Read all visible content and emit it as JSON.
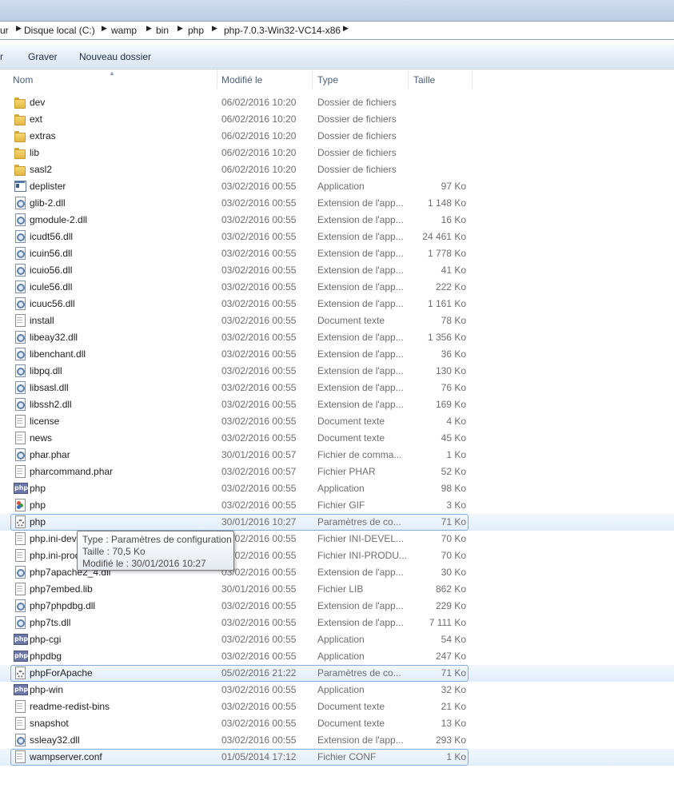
{
  "breadcrumb": [
    "ur",
    "Disque local (C:)",
    "wamp",
    "bin",
    "php",
    "php-7.0.3-Win32-VC14-x86"
  ],
  "toolbar": {
    "partial_label": "r",
    "burn_label": "Graver",
    "new_folder_label": "Nouveau dossier"
  },
  "columns": {
    "name": "Nom",
    "modified": "Modifié le",
    "type": "Type",
    "size": "Taille"
  },
  "files": [
    {
      "name": "dev",
      "date": "06/02/2016 10:20",
      "type": "Dossier de fichiers",
      "size": "",
      "icon": "folder"
    },
    {
      "name": "ext",
      "date": "06/02/2016 10:20",
      "type": "Dossier de fichiers",
      "size": "",
      "icon": "folder"
    },
    {
      "name": "extras",
      "date": "06/02/2016 10:20",
      "type": "Dossier de fichiers",
      "size": "",
      "icon": "folder"
    },
    {
      "name": "lib",
      "date": "06/02/2016 10:20",
      "type": "Dossier de fichiers",
      "size": "",
      "icon": "folder"
    },
    {
      "name": "sasl2",
      "date": "06/02/2016 10:20",
      "type": "Dossier de fichiers",
      "size": "",
      "icon": "folder"
    },
    {
      "name": "deplister",
      "date": "03/02/2016 00:55",
      "type": "Application",
      "size": "97 Ko",
      "icon": "app"
    },
    {
      "name": "glib-2.dll",
      "date": "03/02/2016 00:55",
      "type": "Extension de l'app...",
      "size": "1 148 Ko",
      "icon": "dll"
    },
    {
      "name": "gmodule-2.dll",
      "date": "03/02/2016 00:55",
      "type": "Extension de l'app...",
      "size": "16 Ko",
      "icon": "dll"
    },
    {
      "name": "icudt56.dll",
      "date": "03/02/2016 00:55",
      "type": "Extension de l'app...",
      "size": "24 461 Ko",
      "icon": "dll"
    },
    {
      "name": "icuin56.dll",
      "date": "03/02/2016 00:55",
      "type": "Extension de l'app...",
      "size": "1 778 Ko",
      "icon": "dll"
    },
    {
      "name": "icuio56.dll",
      "date": "03/02/2016 00:55",
      "type": "Extension de l'app...",
      "size": "41 Ko",
      "icon": "dll"
    },
    {
      "name": "icule56.dll",
      "date": "03/02/2016 00:55",
      "type": "Extension de l'app...",
      "size": "222 Ko",
      "icon": "dll"
    },
    {
      "name": "icuuc56.dll",
      "date": "03/02/2016 00:55",
      "type": "Extension de l'app...",
      "size": "1 161 Ko",
      "icon": "dll"
    },
    {
      "name": "install",
      "date": "03/02/2016 00:55",
      "type": "Document texte",
      "size": "78 Ko",
      "icon": "doc"
    },
    {
      "name": "libeay32.dll",
      "date": "03/02/2016 00:55",
      "type": "Extension de l'app...",
      "size": "1 356 Ko",
      "icon": "dll"
    },
    {
      "name": "libenchant.dll",
      "date": "03/02/2016 00:55",
      "type": "Extension de l'app...",
      "size": "36 Ko",
      "icon": "dll"
    },
    {
      "name": "libpq.dll",
      "date": "03/02/2016 00:55",
      "type": "Extension de l'app...",
      "size": "130 Ko",
      "icon": "dll"
    },
    {
      "name": "libsasl.dll",
      "date": "03/02/2016 00:55",
      "type": "Extension de l'app...",
      "size": "76 Ko",
      "icon": "dll"
    },
    {
      "name": "libssh2.dll",
      "date": "03/02/2016 00:55",
      "type": "Extension de l'app...",
      "size": "169 Ko",
      "icon": "dll"
    },
    {
      "name": "license",
      "date": "03/02/2016 00:55",
      "type": "Document texte",
      "size": "4 Ko",
      "icon": "doc"
    },
    {
      "name": "news",
      "date": "03/02/2016 00:55",
      "type": "Document texte",
      "size": "45 Ko",
      "icon": "doc"
    },
    {
      "name": "phar.phar",
      "date": "30/01/2016 00:57",
      "type": "Fichier de comma...",
      "size": "1 Ko",
      "icon": "dll"
    },
    {
      "name": "pharcommand.phar",
      "date": "03/02/2016 00:57",
      "type": "Fichier PHAR",
      "size": "52 Ko",
      "icon": "doc"
    },
    {
      "name": "php",
      "date": "03/02/2016 00:55",
      "type": "Application",
      "size": "98 Ko",
      "icon": "php"
    },
    {
      "name": "php",
      "date": "03/02/2016 00:55",
      "type": "Fichier GIF",
      "size": "3 Ko",
      "icon": "gif"
    },
    {
      "name": "php",
      "date": "30/01/2016 10:27",
      "type": "Paramètres de co...",
      "size": "71 Ko",
      "icon": "ini",
      "selected": true
    },
    {
      "name": "php.ini-development",
      "date": "03/02/2016 00:55",
      "type": "Fichier INI-DEVEL...",
      "size": "70 Ko",
      "icon": "doc"
    },
    {
      "name": "php.ini-production",
      "date": "03/02/2016 00:55",
      "type": "Fichier INI-PRODU...",
      "size": "70 Ko",
      "icon": "doc"
    },
    {
      "name": "php7apache2_4.dll",
      "date": "03/02/2016 00:55",
      "type": "Extension de l'app...",
      "size": "30 Ko",
      "icon": "dll"
    },
    {
      "name": "php7embed.lib",
      "date": "30/01/2016 00:55",
      "type": "Fichier LIB",
      "size": "862 Ko",
      "icon": "doc"
    },
    {
      "name": "php7phpdbg.dll",
      "date": "03/02/2016 00:55",
      "type": "Extension de l'app...",
      "size": "229 Ko",
      "icon": "dll"
    },
    {
      "name": "php7ts.dll",
      "date": "03/02/2016 00:55",
      "type": "Extension de l'app...",
      "size": "7 111 Ko",
      "icon": "dll"
    },
    {
      "name": "php-cgi",
      "date": "03/02/2016 00:55",
      "type": "Application",
      "size": "54 Ko",
      "icon": "php"
    },
    {
      "name": "phpdbg",
      "date": "03/02/2016 00:55",
      "type": "Application",
      "size": "247 Ko",
      "icon": "php"
    },
    {
      "name": "phpForApache",
      "date": "05/02/2016 21:22",
      "type": "Paramètres de co...",
      "size": "71 Ko",
      "icon": "ini",
      "selected": true
    },
    {
      "name": "php-win",
      "date": "03/02/2016 00:55",
      "type": "Application",
      "size": "32 Ko",
      "icon": "php"
    },
    {
      "name": "readme-redist-bins",
      "date": "03/02/2016 00:55",
      "type": "Document texte",
      "size": "21 Ko",
      "icon": "doc"
    },
    {
      "name": "snapshot",
      "date": "03/02/2016 00:55",
      "type": "Document texte",
      "size": "13 Ko",
      "icon": "doc"
    },
    {
      "name": "ssleay32.dll",
      "date": "03/02/2016 00:55",
      "type": "Extension de l'app...",
      "size": "293 Ko",
      "icon": "dll"
    },
    {
      "name": "wampserver.conf",
      "date": "01/05/2014 17:12",
      "type": "Fichier CONF",
      "size": "1 Ko",
      "icon": "doc",
      "selected": true
    }
  ],
  "tooltip": {
    "type_line": "Type : Paramètres de configuration",
    "size_line": "Taille : 70,5 Ko",
    "modified_line": "Modifié le : 30/01/2016 10:27"
  }
}
